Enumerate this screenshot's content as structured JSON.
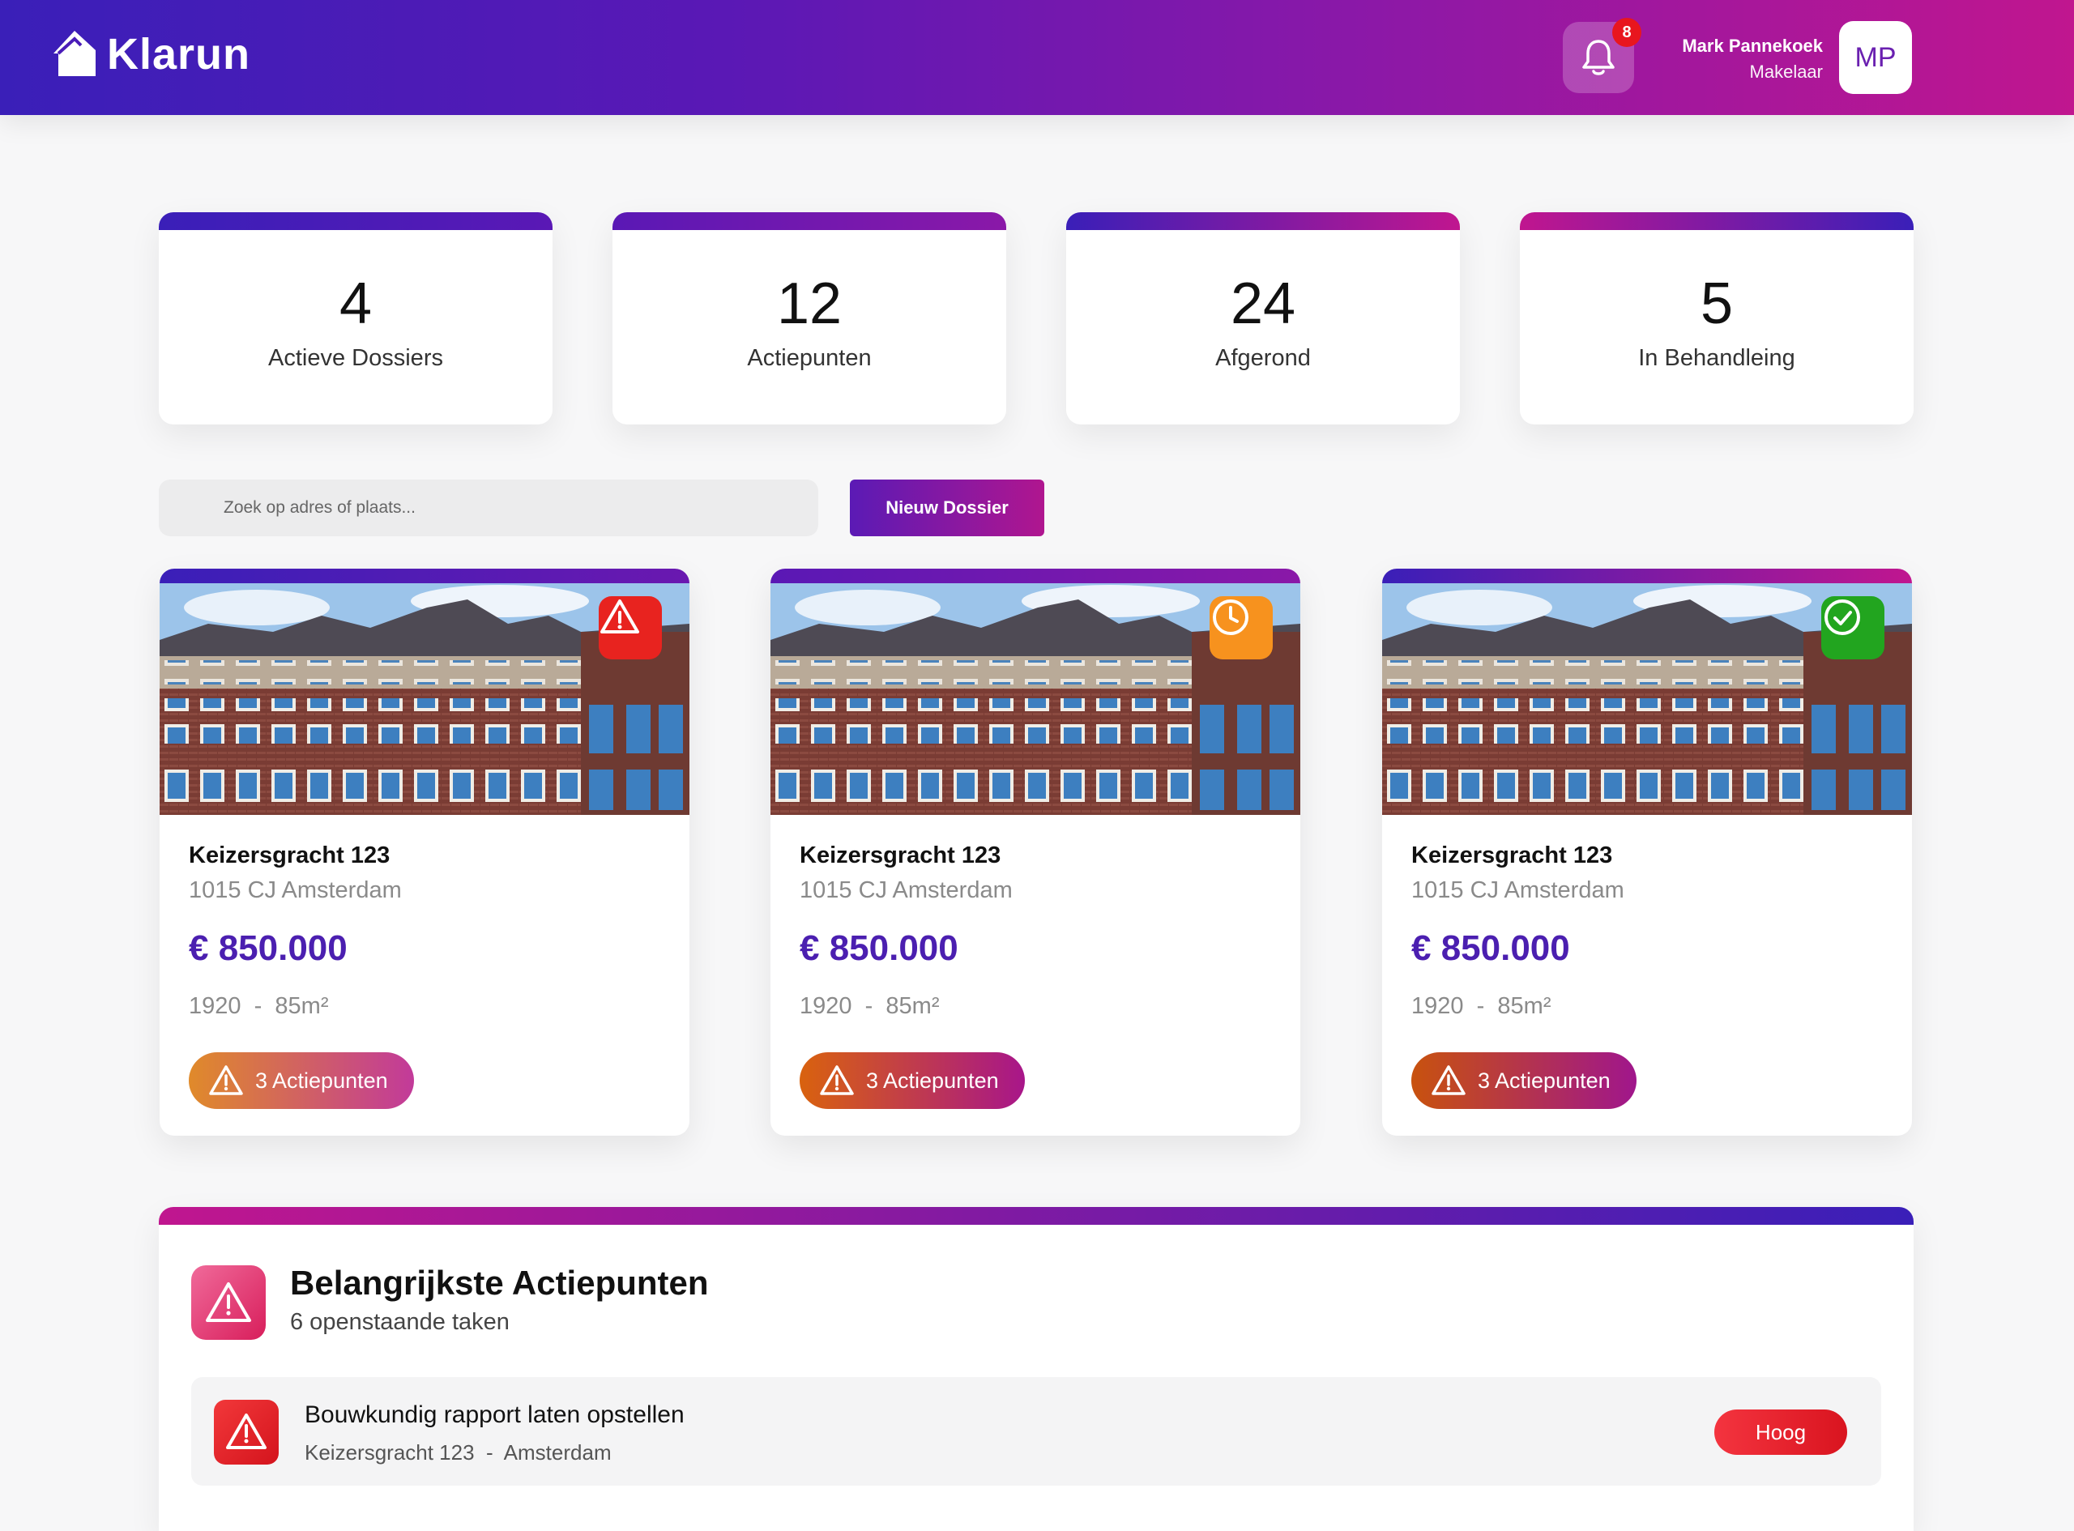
{
  "app": {
    "name": "Klarun",
    "notifications_count": "8",
    "user_name": "Mark Pannekoek",
    "user_role": "Makelaar",
    "user_initials": "MP"
  },
  "stats": [
    {
      "value": "4",
      "label": "Actieve Dossiers"
    },
    {
      "value": "12",
      "label": "Actiepunten"
    },
    {
      "value": "24",
      "label": "Afgerond"
    },
    {
      "value": "5",
      "label": "In Behandleing"
    }
  ],
  "search": {
    "placeholder": "Zoek op adres of plaats..."
  },
  "toolbar": {
    "new_label": "Nieuw Dossier"
  },
  "properties": [
    {
      "address": "Keizersgracht 123",
      "city": "1015 CJ Amsterdam",
      "price": "€ 850.000",
      "meta": "1920  -  85m²",
      "actions": "3 Actiepunten",
      "status": "warning-icon",
      "status_color": "#e8231f"
    },
    {
      "address": "Keizersgracht 123",
      "city": "1015 CJ Amsterdam",
      "price": "€ 850.000",
      "meta": "1920  -  85m²",
      "actions": "3 Actiepunten",
      "status": "clock-icon",
      "status_color": "#f7921e"
    },
    {
      "address": "Keizersgracht 123",
      "city": "1015 CJ Amsterdam",
      "price": "€ 850.000",
      "meta": "1920  -  85m²",
      "actions": "3 Actiepunten",
      "status": "check-icon",
      "status_color": "#22a51f"
    }
  ],
  "panel": {
    "title": "Belangrijkste Actiepunten",
    "subtitle": "6 openstaande taken",
    "tasks": [
      {
        "title": "Bouwkundig rapport laten opstellen",
        "sub": "Keizersgracht 123  -  Amsterdam",
        "priority": "Hoog"
      }
    ]
  },
  "colors": {
    "primary": "#4b1fb0",
    "accent": "#c0168f",
    "danger": "#e8231f"
  }
}
